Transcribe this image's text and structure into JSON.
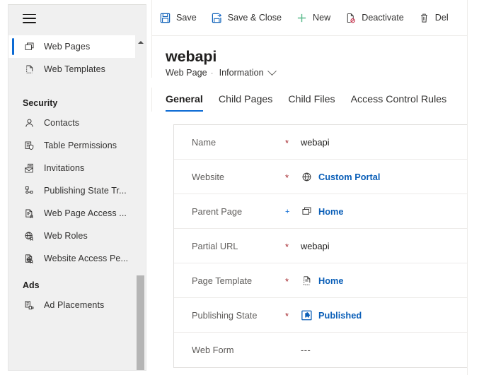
{
  "sidebar": {
    "menu_icon": "hamburger-icon",
    "items": [
      {
        "type": "item",
        "label": "Web Pages",
        "icon": "web-pages-icon",
        "selected": true
      },
      {
        "type": "item",
        "label": "Web Templates",
        "icon": "web-templates-icon",
        "selected": false
      },
      {
        "type": "group",
        "label": "Security"
      },
      {
        "type": "item",
        "label": "Contacts",
        "icon": "contact-person-icon",
        "selected": false
      },
      {
        "type": "item",
        "label": "Table  Permissions",
        "icon": "table-permissions-icon",
        "selected": false
      },
      {
        "type": "item",
        "label": "Invitations",
        "icon": "invitations-envelope-icon",
        "selected": false
      },
      {
        "type": "item",
        "label": "Publishing State Tr...",
        "icon": "publishing-state-icon",
        "selected": false
      },
      {
        "type": "item",
        "label": "Web Page Access ...",
        "icon": "web-page-access-icon",
        "selected": false
      },
      {
        "type": "item",
        "label": "Web Roles",
        "icon": "web-roles-globe-icon",
        "selected": false
      },
      {
        "type": "item",
        "label": "Website Access Pe...",
        "icon": "website-access-icon",
        "selected": false
      },
      {
        "type": "group",
        "label": "Ads"
      },
      {
        "type": "item",
        "label": "Ad Placements",
        "icon": "ad-placements-icon",
        "selected": false
      }
    ],
    "scrollbar": {
      "up_arrow": "scroll-up-arrow-icon"
    }
  },
  "commandbar": {
    "buttons": [
      {
        "label": "Save",
        "icon": "save-floppy-icon"
      },
      {
        "label": "Save & Close",
        "icon": "save-and-close-icon"
      },
      {
        "label": "New",
        "icon": "plus-new-icon"
      },
      {
        "label": "Deactivate",
        "icon": "deactivate-icon"
      },
      {
        "label": "Del",
        "icon": "delete-trash-icon"
      }
    ]
  },
  "header": {
    "record_title": "webapi",
    "entity_name": "Web Page",
    "separator": "·",
    "form_name": "Information",
    "form_chevron": "chevron-down-icon"
  },
  "tabs": [
    {
      "label": "General",
      "active": true
    },
    {
      "label": "Child Pages",
      "active": false
    },
    {
      "label": "Child Files",
      "active": false
    },
    {
      "label": "Access Control Rules",
      "active": false
    }
  ],
  "form": {
    "fields": [
      {
        "label": "Name",
        "marker": "*",
        "marker_type": "required",
        "value": "webapi",
        "icon": null,
        "is_link": false
      },
      {
        "label": "Website",
        "marker": "*",
        "marker_type": "required",
        "value": "Custom Portal",
        "icon": "globe-icon",
        "is_link": true
      },
      {
        "label": "Parent Page",
        "marker": "+",
        "marker_type": "optional",
        "value": "Home",
        "icon": "web-pages-icon",
        "is_link": true
      },
      {
        "label": "Partial URL",
        "marker": "*",
        "marker_type": "required",
        "value": "webapi",
        "icon": null,
        "is_link": false
      },
      {
        "label": "Page Template",
        "marker": "*",
        "marker_type": "required",
        "value": "Home",
        "icon": "page-template-icon",
        "is_link": true
      },
      {
        "label": "Publishing State",
        "marker": "*",
        "marker_type": "required",
        "value": "Published",
        "icon": "publishing-state-badge",
        "is_link": true
      },
      {
        "label": "Web Form",
        "marker": "",
        "marker_type": "none",
        "value": "---",
        "icon": null,
        "is_link": false
      }
    ]
  },
  "colors": {
    "accent_blue": "#0b6ad4",
    "link_blue": "#0b5fb8",
    "required_red": "#a4262c",
    "new_green": "#5aba8c",
    "sidebar_bg": "#f0f0f0"
  }
}
